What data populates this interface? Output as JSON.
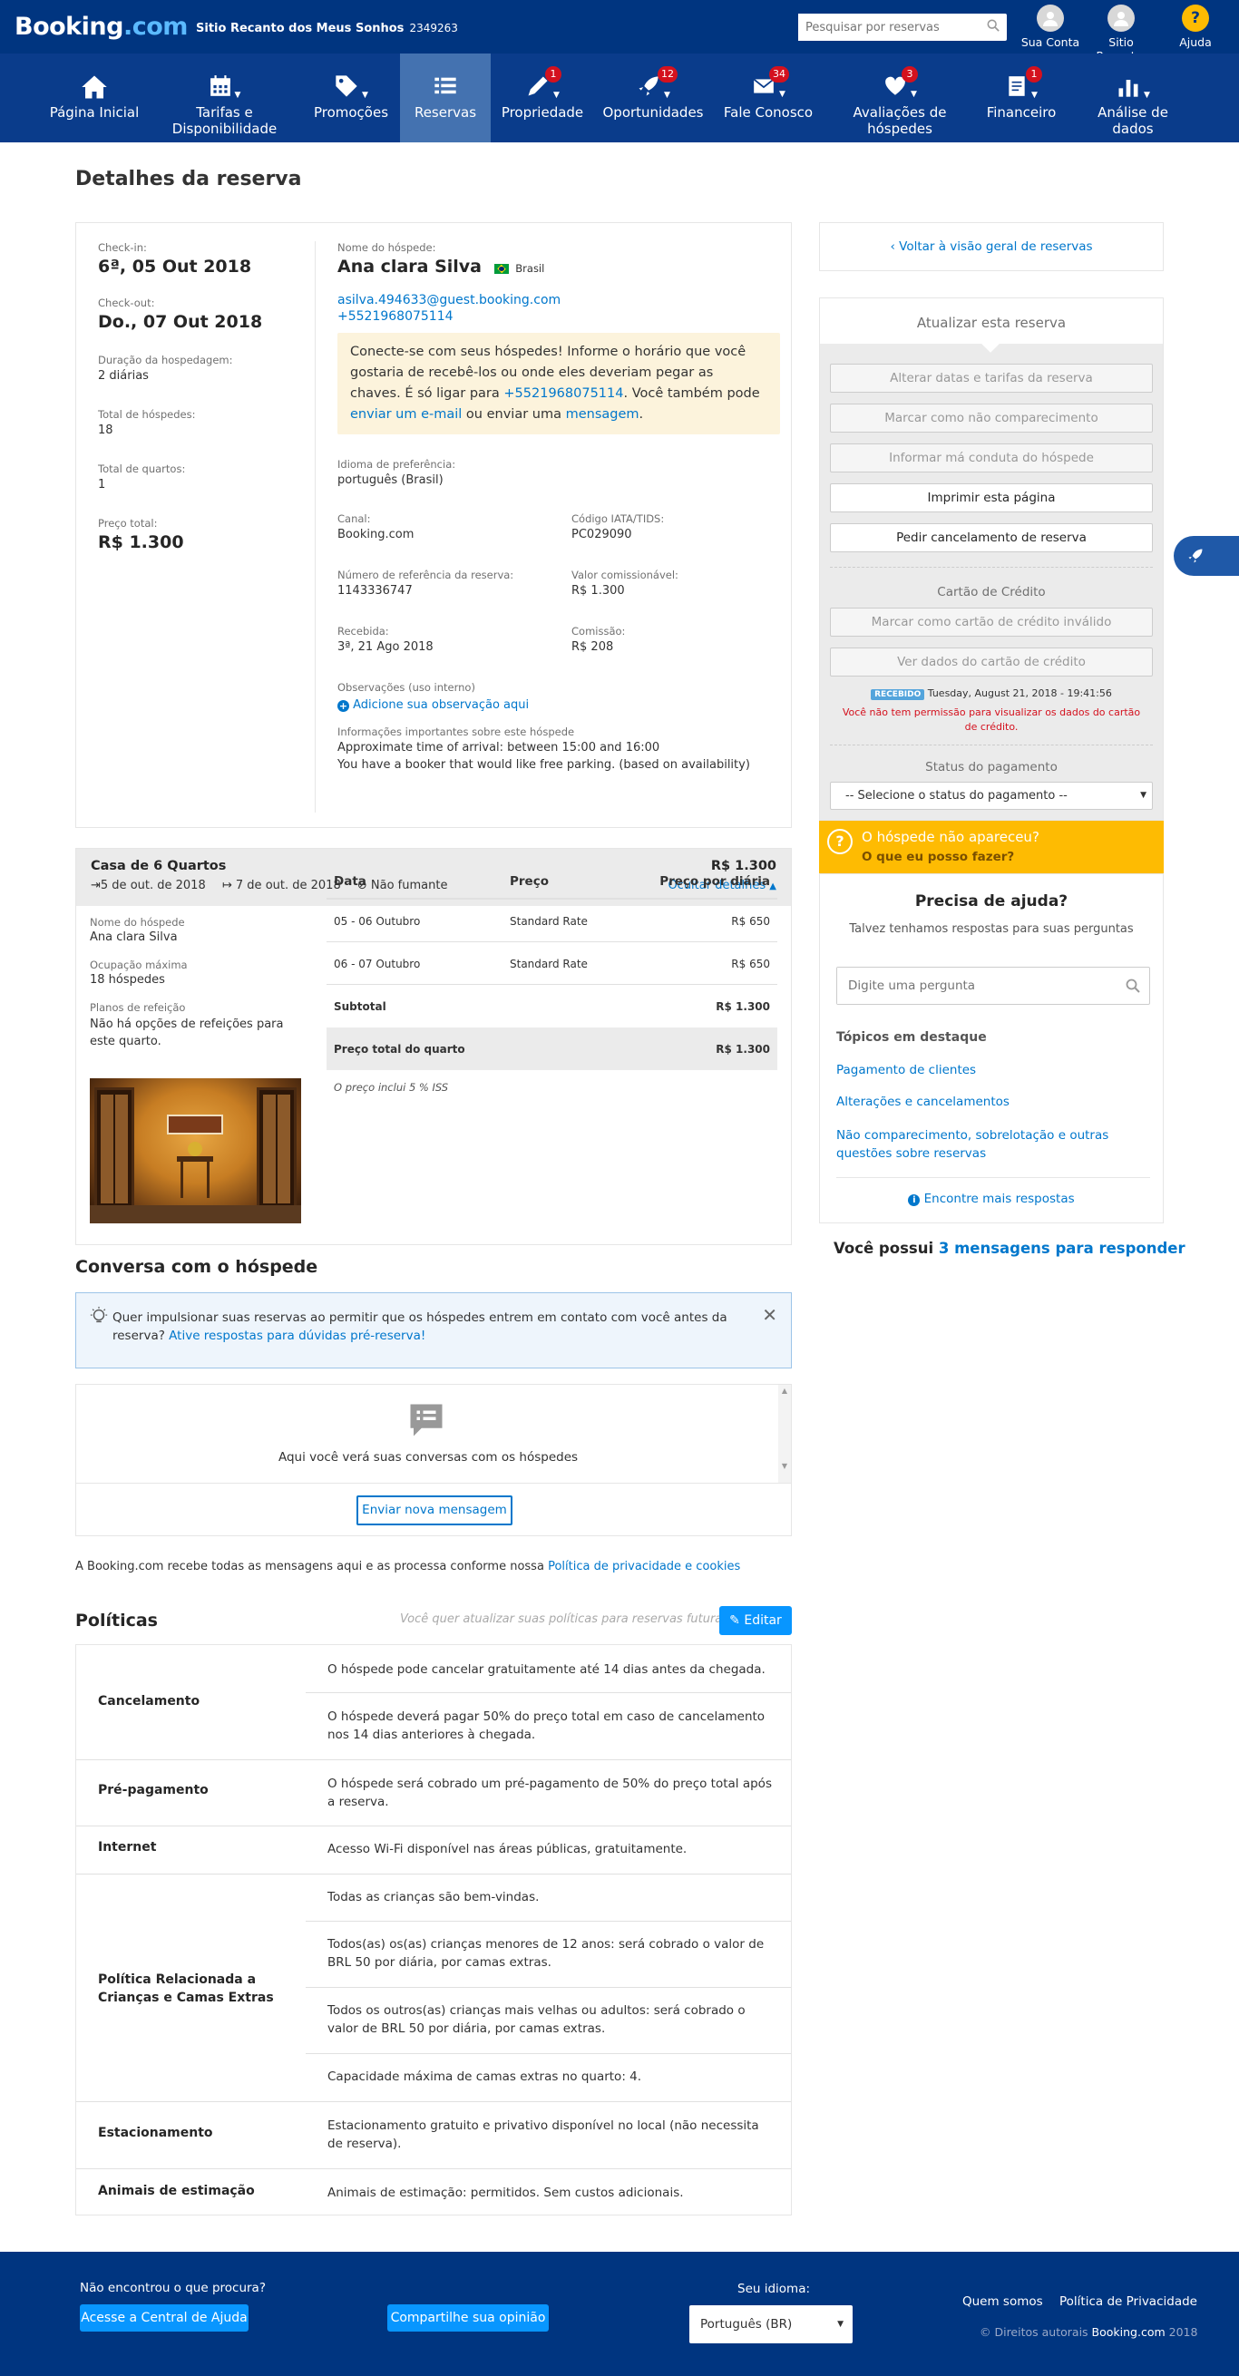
{
  "header": {
    "logo_main": "Booking",
    "logo_dotcom": ".com",
    "property_name": "Sitio Recanto dos Meus Sonhos",
    "property_id": "2349263",
    "search_placeholder": "Pesquisar por reservas",
    "account_label": "Sua Conta",
    "property_short": "Sitio Recant...",
    "help_label": "Ajuda",
    "help_symbol": "?"
  },
  "nav": {
    "items": [
      {
        "label": "Página Inicial"
      },
      {
        "label": "Tarifas e Disponibilidade"
      },
      {
        "label": "Promoções"
      },
      {
        "label": "Reservas"
      },
      {
        "label": "Propriedade",
        "badge": "1"
      },
      {
        "label": "Oportunidades",
        "badge": "12"
      },
      {
        "label": "Fale Conosco",
        "badge": "34"
      },
      {
        "label": "Avaliações de hóspedes",
        "badge": "3"
      },
      {
        "label": "Financeiro",
        "badge": "1"
      },
      {
        "label": "Análise de dados"
      }
    ]
  },
  "page_title": "Detalhes da reserva",
  "details": {
    "checkin_label": "Check-in:",
    "checkin_value": "6ª, 05 Out 2018",
    "checkout_label": "Check-out:",
    "checkout_value": "Do., 07 Out 2018",
    "duration_label": "Duração da hospedagem:",
    "duration_value": "2 diárias",
    "guests_label": "Total de hóspedes:",
    "guests_value": "18",
    "rooms_label": "Total de quartos:",
    "rooms_value": "1",
    "price_label": "Preço total:",
    "price_value": "R$ 1.300",
    "guest_name_label": "Nome do hóspede:",
    "guest_name": "Ana clara Silva",
    "guest_country": "Brasil",
    "guest_email": "asilva.494633@guest.booking.com",
    "guest_phone": "+5521968075114",
    "notice_part1": "Conecte-se com seus hóspedes! Informe o horário que você gostaria de recebê-los ou onde eles deveriam pegar as chaves. É só ligar para ",
    "notice_phone": "+5521968075114",
    "notice_part2": ". Você também pode ",
    "notice_email_link": "enviar um e-mail",
    "notice_part3": " ou enviar uma ",
    "notice_msg_link": "mensagem",
    "notice_part4": ".",
    "language_label": "Idioma de preferência:",
    "language_value": "português (Brasil)",
    "channel_label": "Canal:",
    "channel_value": "Booking.com",
    "iata_label": "Código IATA/TIDS:",
    "iata_value": "PC029090",
    "ref_label": "Número de referência da reserva:",
    "ref_value": "1143336747",
    "commissionable_label": "Valor comissionável:",
    "commissionable_value": "R$ 1.300",
    "received_label": "Recebida:",
    "received_value": "3ª, 21 Ago 2018",
    "commission_label": "Comissão:",
    "commission_value": "R$ 208",
    "notes_label": "Observações (uso interno)",
    "notes_add": "Adicione sua observação aqui",
    "important_label": "Informações importantes sobre este hóspede",
    "important_line1": "Approximate time of arrival: between 15:00 and 16:00",
    "important_line2": "You have a booker that would like free parking. (based on availability)"
  },
  "room": {
    "title": "Casa de 6 Quartos",
    "price": "R$ 1.300",
    "checkin": "5 de out. de 2018",
    "checkout": "7 de out. de 2018",
    "smoking": "Não fumante",
    "hide_details": "Ocultar detalhes",
    "guest_label": "Nome do hóspede",
    "guest_value": "Ana clara Silva",
    "occupancy_label": "Ocupação máxima",
    "occupancy_value": "18 hóspedes",
    "meal_label": "Planos de refeição",
    "meal_value": "Não há opções de refeições para este quarto.",
    "col_date": "Data",
    "col_price": "Preço",
    "col_daily": "Preço por diária",
    "rows": [
      {
        "date": "05 - 06 Outubro",
        "rate": "Standard Rate",
        "amount": "R$ 650"
      },
      {
        "date": "06 - 07 Outubro",
        "rate": "Standard Rate",
        "amount": "R$ 650"
      }
    ],
    "subtotal_label": "Subtotal",
    "subtotal_value": "R$ 1.300",
    "total_label": "Preço total do quarto",
    "total_value": "R$ 1.300",
    "iss_note": "O preço inclui 5 % ISS"
  },
  "conversation": {
    "title": "Conversa com o hóspede",
    "tip_text": "Quer impulsionar suas reservas ao permitir que os hóspedes entrem em contato com você antes da reserva? ",
    "tip_link": "Ative respostas para dúvidas pré-reserva!",
    "empty_text": "Aqui você verá suas conversas com os hóspedes",
    "new_message": "Enviar nova mensagem",
    "privacy_text": "A Booking.com recebe todas as mensagens aqui e as processa conforme nossa ",
    "privacy_link": "Política de privacidade e cookies"
  },
  "policies": {
    "title": "Políticas",
    "question": "Você quer atualizar suas políticas para reservas futuras?",
    "edit": "Editar",
    "cancel_title": "Cancelamento",
    "cancel_1": "O hóspede pode cancelar gratuitamente até 14 dias antes da chegada.",
    "cancel_2": "O hóspede deverá pagar 50% do preço total em caso de cancelamento nos 14 dias anteriores à chegada.",
    "prepay_title": "Pré-pagamento",
    "prepay_1": "O hóspede será cobrado um pré-pagamento de 50% do preço total após a reserva.",
    "internet_title": "Internet",
    "internet_1": "Acesso Wi-Fi disponível nas áreas públicas, gratuitamente.",
    "children_title": "Política Relacionada a Crianças e Camas Extras",
    "children_1": "Todas as crianças são bem-vindas.",
    "children_2": "Todos(as) os(as) crianças menores de 12 anos: será cobrado o valor de BRL 50 por diária, por camas extras.",
    "children_3": "Todos os outros(as) crianças mais velhas ou adultos: será cobrado o valor de BRL 50 por diária, por camas extras.",
    "children_4": "Capacidade máxima de camas extras no quarto: 4.",
    "parking_title": "Estacionamento",
    "parking_1": "Estacionamento gratuito e privativo disponível no local (não necessita de reserva).",
    "pets_title": "Animais de estimação",
    "pets_1": "Animais de estimação: permitidos. Sem custos adicionais."
  },
  "sidebar": {
    "back_link": "Voltar à visão geral de reservas",
    "update_title": "Atualizar esta reserva",
    "btn_change": "Alterar datas e tarifas da reserva",
    "btn_noshow": "Marcar como não comparecimento",
    "btn_misconduct": "Informar má conduta do hóspede",
    "btn_print": "Imprimir esta página",
    "btn_cancel": "Pedir cancelamento de reserva",
    "card_title": "Cartão de Crédito",
    "btn_invalid_card": "Marcar como cartão de crédito inválido",
    "btn_view_card": "Ver dados do cartão de crédito",
    "received_badge": "RECEBIDO",
    "received_time": "Tuesday, August 21, 2018 - 19:41:56",
    "no_permission": "Você não tem permissão para visualizar os dados do cartão de crédito.",
    "payment_status_label": "Status do pagamento",
    "payment_status_value": "-- Selecione o status do pagamento --",
    "noshow_question": "O hóspede não apareceu?",
    "noshow_action": "O que eu posso fazer?",
    "help_title": "Precisa de ajuda?",
    "help_subtitle": "Talvez tenhamos respostas para suas perguntas",
    "help_placeholder": "Digite uma pergunta",
    "topics_title": "Tópicos em destaque",
    "topic_1": "Pagamento de clientes",
    "topic_2": "Alterações e cancelamentos",
    "topic_3": "Não comparecimento, sobrelotação e outras questões sobre reservas",
    "more_answers": "Encontre mais respostas",
    "messages_prefix": "Você possui ",
    "messages_link": "3 mensagens para responder"
  },
  "footer": {
    "not_found": "Não encontrou o que procura?",
    "help_center": "Acesse a Central de Ajuda",
    "share_opinion": "Compartilhe sua opinião",
    "language_label": "Seu idioma:",
    "language_value": "Português (BR)",
    "about": "Quem somos",
    "privacy": "Política de Privacidade",
    "copyright_prefix": "© Direitos autorais ",
    "copyright_brand": "Booking.com",
    "copyright_year": " 2018"
  },
  "colors": {
    "brand_dark": "#003580",
    "nav": "#0a3c8b",
    "nav_active": "#4472b0",
    "link": "#0077cc",
    "yellow": "#febb02",
    "badge": "#d4111e"
  }
}
